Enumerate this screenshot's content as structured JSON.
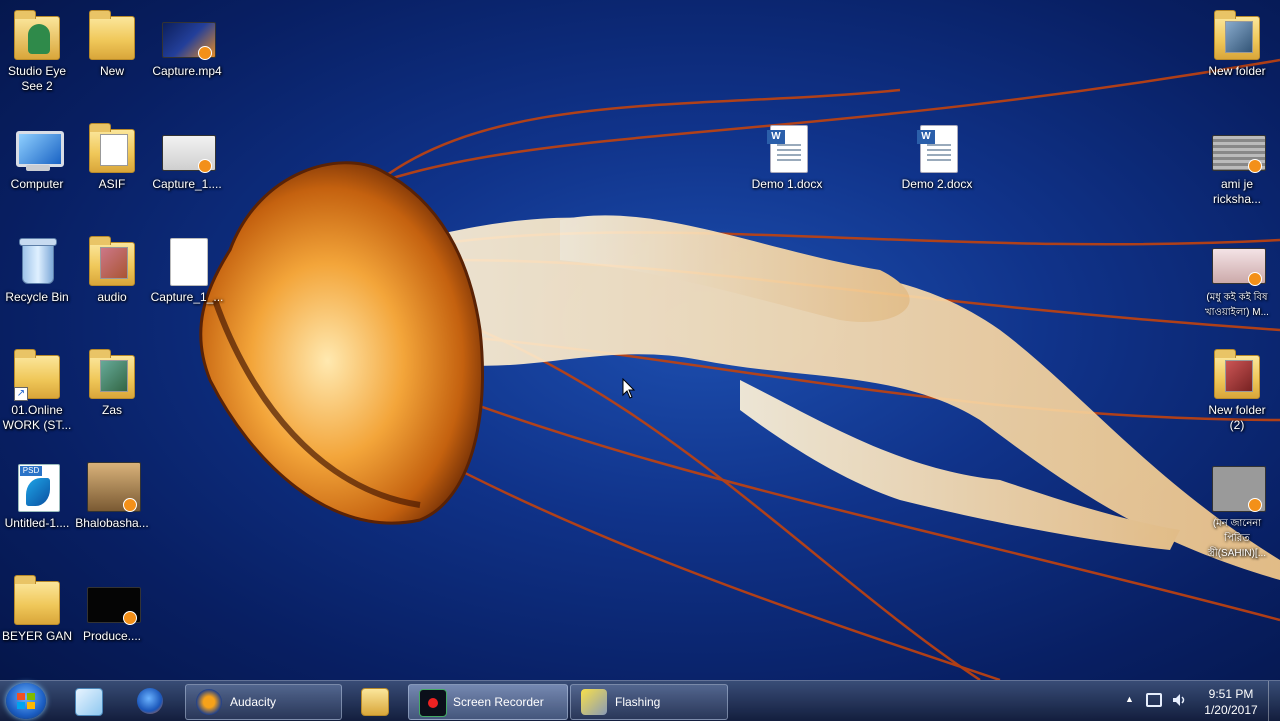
{
  "desktop": {
    "icons_left": [
      {
        "label": "Studio Eye See 2",
        "type": "app"
      },
      {
        "label": "New",
        "type": "folder"
      },
      {
        "label": "Capture.mp4",
        "type": "video"
      },
      {
        "label": "Computer",
        "type": "computer"
      },
      {
        "label": "ASIF",
        "type": "folder"
      },
      {
        "label": "Capture_1....",
        "type": "video"
      },
      {
        "label": "Recycle Bin",
        "type": "recycle"
      },
      {
        "label": "audio",
        "type": "folder"
      },
      {
        "label": "Capture_1_...",
        "type": "file"
      },
      {
        "label": "01.Online WORK (ST...",
        "type": "shortcut-folder"
      },
      {
        "label": "Zas",
        "type": "folder"
      },
      {
        "label": "Untitled-1....",
        "type": "psd"
      },
      {
        "label": "Bhalobasha...",
        "type": "video"
      },
      {
        "label": "BEYER GAN",
        "type": "folder"
      },
      {
        "label": "Produce....",
        "type": "video"
      }
    ],
    "icons_center": [
      {
        "label": "Demo 1.docx",
        "type": "docx"
      },
      {
        "label": "Demo 2.docx",
        "type": "docx"
      }
    ],
    "icons_right": [
      {
        "label": "New folder",
        "type": "folder"
      },
      {
        "label": "ami je ricksha...",
        "type": "video"
      },
      {
        "label": "(মধু কই কই বিষ খাওয়াইলা) M...",
        "type": "video"
      },
      {
        "label": "New folder (2)",
        "type": "folder"
      },
      {
        "label": "(মন জানেনা পিরিত স্ত্রী(SAHIN)[...",
        "type": "video"
      }
    ]
  },
  "taskbar": {
    "pinned": [
      {
        "name": "photoshop-pinned",
        "icon": "feather-icon"
      },
      {
        "name": "firefox-pinned",
        "icon": "firefox-icon"
      },
      {
        "name": "explorer-pinned",
        "icon": "folder-icon"
      }
    ],
    "tasks": [
      {
        "label": "Audacity",
        "icon": "headphones-icon"
      },
      {
        "label": "Screen Recorder",
        "icon": "recorder-icon"
      },
      {
        "label": "Flashing",
        "icon": "flashing-icon"
      }
    ],
    "tray": {
      "arrow": "▲",
      "time": "9:51 PM",
      "date": "1/20/2017"
    }
  },
  "colors": {
    "wallpaper_blue": "#10338a",
    "jellyfish_orange": "#e08a1a",
    "taskbar": "#1e2c50"
  }
}
